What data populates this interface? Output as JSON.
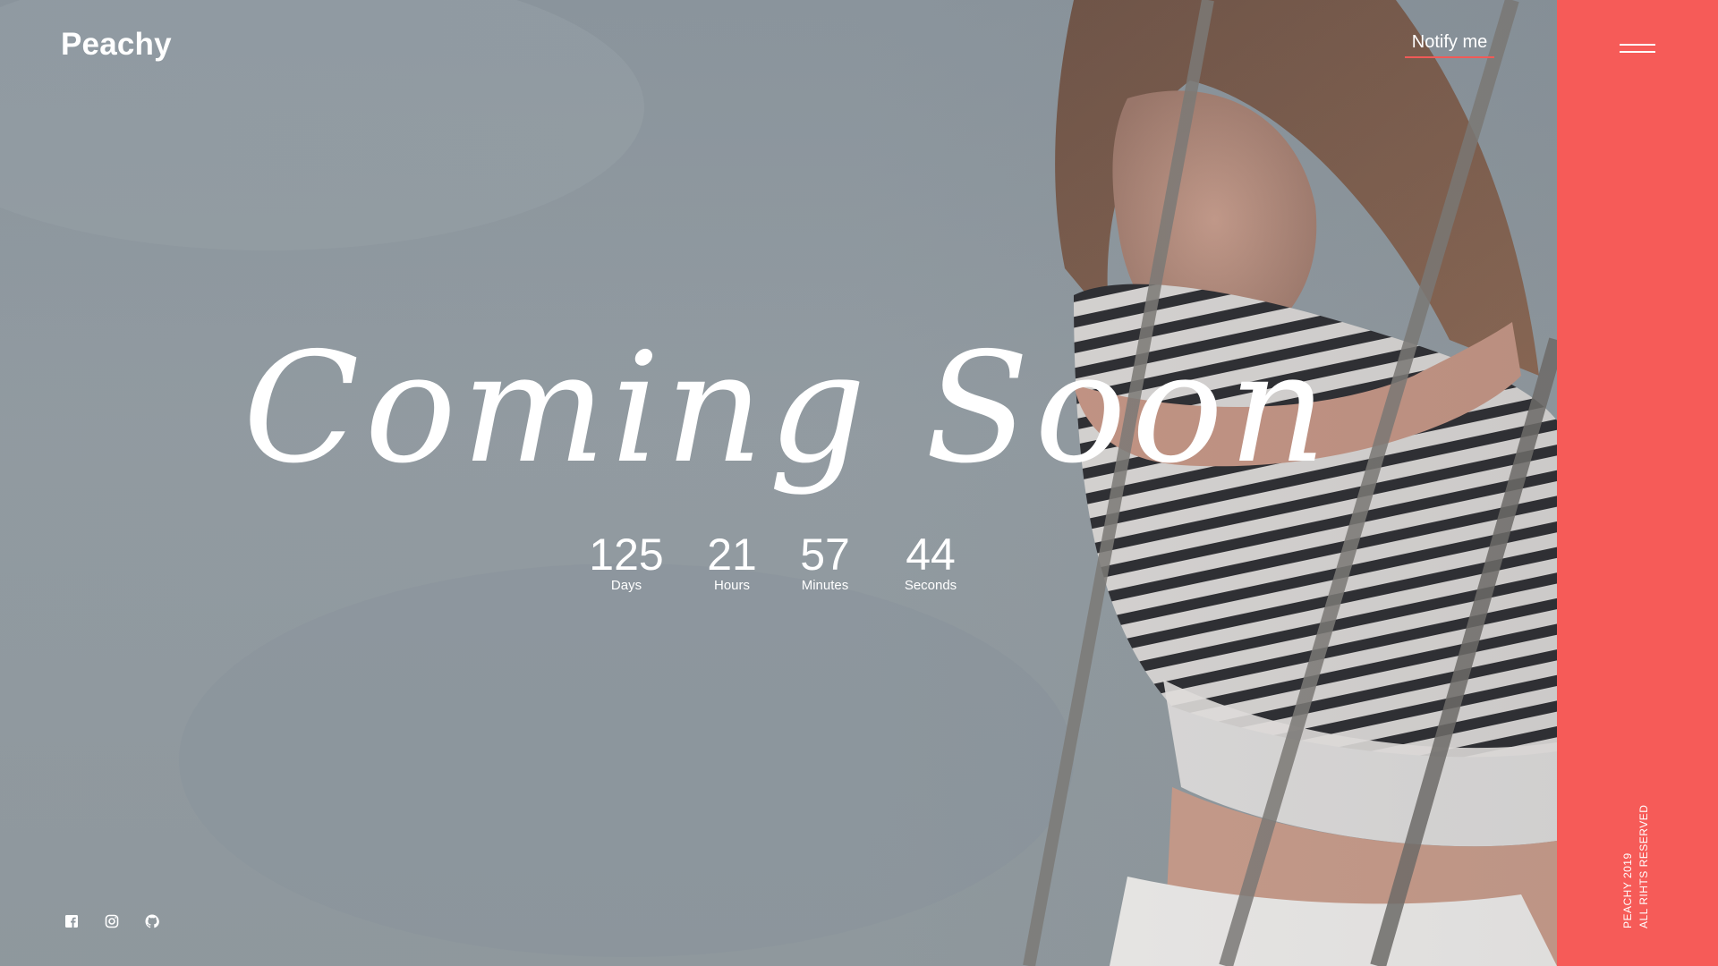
{
  "brand": {
    "name": "Peachy"
  },
  "header": {
    "notify_label": "Notify me",
    "menu_icon": "hamburger-menu-icon"
  },
  "hero": {
    "headline": "Coming Soon"
  },
  "countdown": {
    "days": {
      "value": "125",
      "label": "Days"
    },
    "hours": {
      "value": "21",
      "label": "Hours"
    },
    "minutes": {
      "value": "57",
      "label": "Minutes"
    },
    "seconds": {
      "value": "44",
      "label": "Seconds"
    }
  },
  "footer": {
    "copyright_line1": "PEACHY 2019",
    "copyright_line2": "ALL RIHTS RESERVED"
  },
  "social": [
    {
      "icon": "facebook-icon"
    },
    {
      "icon": "instagram-icon"
    },
    {
      "icon": "github-icon"
    }
  ],
  "colors": {
    "accent": "#f65b58",
    "text": "#ffffff",
    "background": "#8c959c"
  }
}
